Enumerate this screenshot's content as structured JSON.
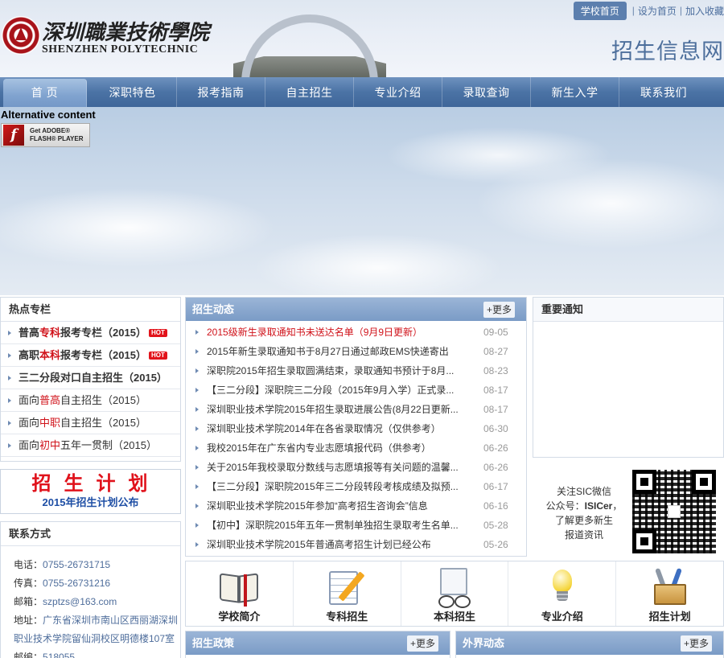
{
  "header": {
    "logo_cn": "深圳職業技術學院",
    "logo_en": "SHENZHEN POLYTECHNIC",
    "top_links": {
      "home": "学校首页",
      "set_home": "设为首页",
      "favorite": "加入收藏"
    },
    "site_title": "招生信息网"
  },
  "nav": [
    "首 页",
    "深职特色",
    "报考指南",
    "自主招生",
    "专业介绍",
    "录取查询",
    "新生入学",
    "联系我们"
  ],
  "banner": {
    "alt_content": "Alternative content",
    "flash_badge": {
      "line1": "Get ADOBE®",
      "line2": "FLASH® PLAYER"
    }
  },
  "hot": {
    "title": "热点专栏",
    "items": [
      {
        "pre": "普高",
        "hl": "专科",
        "post": "报考专栏（2015）",
        "hot": "HOT"
      },
      {
        "pre": "高职",
        "hl": "本科",
        "post": "报考专栏（2015）",
        "hot": "HOT"
      },
      {
        "pre": "三二分段对口自主招生（2015）",
        "hl": "",
        "post": "",
        "hot": ""
      },
      {
        "pre": "面向",
        "hl": "普高",
        "post": "自主招生（2015）",
        "hot": ""
      },
      {
        "pre": "面向",
        "hl": "中职",
        "post": "自主招生（2015）",
        "hot": ""
      },
      {
        "pre": "面向",
        "hl": "初中",
        "post": "五年一贯制（2015）",
        "hot": ""
      }
    ]
  },
  "plan": {
    "main": "招生计划",
    "sub": "2015年招生计划公布"
  },
  "contact": {
    "title": "联系方式",
    "phone_label": "电话：",
    "phone": "0755-26731715",
    "fax_label": "传真：",
    "fax": "0755-26731216",
    "email_label": "邮箱：",
    "email": "szptzs@163.com",
    "address_label": "地址：",
    "address_line1": "广东省深圳市南山区西丽湖深圳",
    "address_line2": "职业技术学院留仙洞校区明德楼107室",
    "zip_label": "邮编：",
    "zip": "518055"
  },
  "news": {
    "title": "招生动态",
    "more": "+更多",
    "items": [
      {
        "title": "2015级新生录取通知书未送达名单（9月9日更新）",
        "date": "09-05"
      },
      {
        "title": "2015年新生录取通知书于8月27日通过邮政EMS快递寄出",
        "date": "08-27"
      },
      {
        "title": "深职院2015年招生录取圆满结束，录取通知书预计于8月...",
        "date": "08-23"
      },
      {
        "title": "【三二分段】深职院三二分段（2015年9月入学）正式录...",
        "date": "08-17"
      },
      {
        "title": "深圳职业技术学院2015年招生录取进展公告(8月22日更新...",
        "date": "08-17"
      },
      {
        "title": "深圳职业技术学院2014年在各省录取情况（仅供参考）",
        "date": "06-30"
      },
      {
        "title": "我校2015年在广东省内专业志愿填报代码（供参考）",
        "date": "06-26"
      },
      {
        "title": "关于2015年我校录取分数线与志愿填报等有关问题的温馨...",
        "date": "06-26"
      },
      {
        "title": "【三二分段】深职院2015年三二分段转段考核成绩及拟预...",
        "date": "06-17"
      },
      {
        "title": "深圳职业技术学院2015年参加“高考招生咨询会”信息",
        "date": "06-16"
      },
      {
        "title": "【初中】深职院2015年五年一贯制单独招生录取考生名单...",
        "date": "05-28"
      },
      {
        "title": "深圳职业技术学院2015年普通高考招生计划已经公布",
        "date": "05-26"
      }
    ]
  },
  "notice": {
    "title": "重要通知"
  },
  "wechat": {
    "line1": "关注SIC微信",
    "line2a": "公众号：",
    "line2b": "ISICer",
    "line2c": "，",
    "line3": "了解更多新生",
    "line4": "报道资讯"
  },
  "quick_links": [
    {
      "label": "学校简介",
      "icon": "book-icon"
    },
    {
      "label": "专科招生",
      "icon": "notepad-icon"
    },
    {
      "label": "本科招生",
      "icon": "document-icon"
    },
    {
      "label": "专业介绍",
      "icon": "lightbulb-icon"
    },
    {
      "label": "招生计划",
      "icon": "toolbox-icon"
    }
  ],
  "policy": {
    "title": "招生政策",
    "more": "+更多"
  },
  "outside": {
    "title": "外界动态",
    "more": "+更多"
  },
  "colors": {
    "nav_blue": "#4b73a5",
    "accent_red": "#d0121a",
    "link_blue": "#4e6d9b"
  }
}
